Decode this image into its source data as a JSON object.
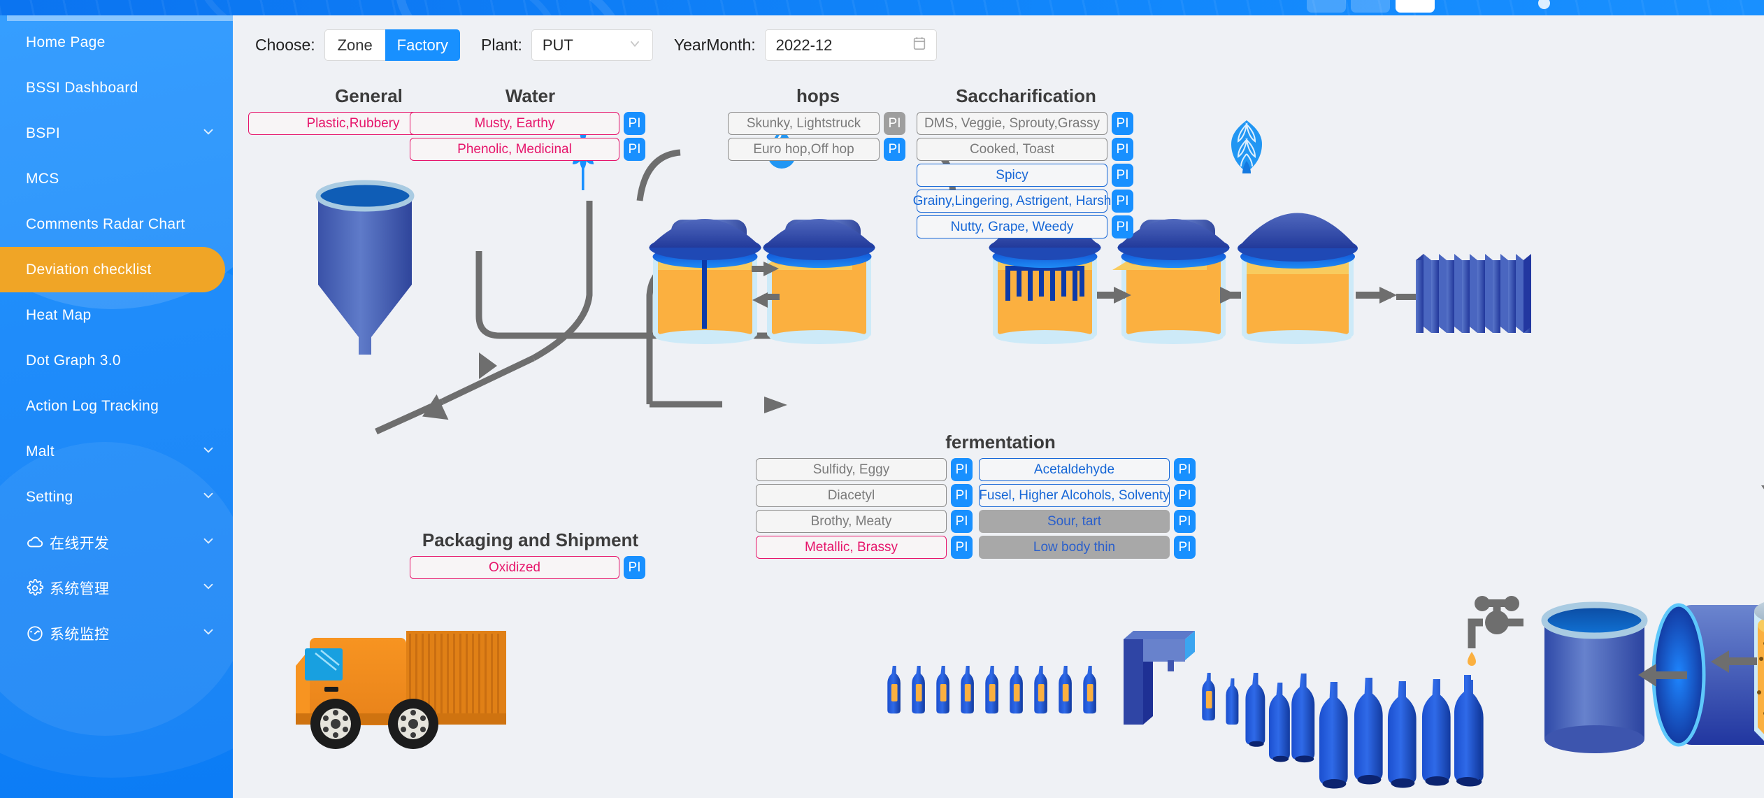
{
  "header": {
    "pill_1": "",
    "pill_2": "",
    "pill_3": ""
  },
  "sidebar": {
    "items": [
      {
        "label": "Home Page",
        "icon": "",
        "caret": false,
        "active": false
      },
      {
        "label": "BSSI Dashboard",
        "icon": "",
        "caret": false,
        "active": false
      },
      {
        "label": "BSPI",
        "icon": "",
        "caret": true,
        "active": false
      },
      {
        "label": "MCS",
        "icon": "",
        "caret": false,
        "active": false
      },
      {
        "label": "Comments Radar Chart",
        "icon": "",
        "caret": false,
        "active": false
      },
      {
        "label": "Deviation checklist",
        "icon": "",
        "caret": false,
        "active": true
      },
      {
        "label": "Heat Map",
        "icon": "",
        "caret": false,
        "active": false
      },
      {
        "label": "Dot Graph 3.0",
        "icon": "",
        "caret": false,
        "active": false
      },
      {
        "label": "Action Log Tracking",
        "icon": "",
        "caret": false,
        "active": false
      },
      {
        "label": "Malt",
        "icon": "",
        "caret": true,
        "active": false
      },
      {
        "label": "Setting",
        "icon": "",
        "caret": true,
        "active": false
      },
      {
        "label": "在线开发",
        "icon": "cloud-icon",
        "caret": true,
        "active": false
      },
      {
        "label": "系统管理",
        "icon": "gear-icon",
        "caret": true,
        "active": false
      },
      {
        "label": "系统监控",
        "icon": "gauge-icon",
        "caret": true,
        "active": false
      }
    ],
    "active_color": "#f0a526"
  },
  "toolbar": {
    "choose_label": "Choose:",
    "segment": {
      "options": [
        "Zone",
        "Factory"
      ],
      "selected": "Factory"
    },
    "plant_label": "Plant:",
    "plant_value": "PUT",
    "yearmonth_label": "YearMonth:",
    "yearmonth_value": "2022-12"
  },
  "colors": {
    "accent": "#1890ff",
    "active_nav": "#f0a526",
    "chip_neutral": "#8c8c8c",
    "chip_blue": "#1566d6",
    "chip_pink": "#e6156b",
    "chip_filled_bg": "#a8a8a8",
    "pi_disabled": "#9e9e9e",
    "background": "#eff1f5"
  },
  "groups": {
    "general": {
      "title": "General",
      "rows": [
        {
          "label": "Plastic,Rubbery",
          "state": "pink",
          "pi": "PI",
          "pi_enabled": true
        }
      ]
    },
    "water": {
      "title": "Water",
      "rows": [
        {
          "label": "Musty, Earthy",
          "state": "pink",
          "pi": "PI",
          "pi_enabled": true
        },
        {
          "label": "Phenolic, Medicinal",
          "state": "pink",
          "pi": "PI",
          "pi_enabled": true
        }
      ]
    },
    "hops": {
      "title": "hops",
      "rows": [
        {
          "label": "Skunky, Lightstruck",
          "state": "neutral",
          "pi": "PI",
          "pi_enabled": false
        },
        {
          "label": "Euro hop,Off hop",
          "state": "neutral",
          "pi": "PI",
          "pi_enabled": true
        }
      ]
    },
    "saccharification": {
      "title": "Saccharification",
      "rows": [
        {
          "label": "DMS, Veggie, Sprouty,Grassy",
          "state": "neutral",
          "pi": "PI",
          "pi_enabled": true
        },
        {
          "label": "Cooked, Toast",
          "state": "neutral",
          "pi": "PI",
          "pi_enabled": true
        },
        {
          "label": "Spicy",
          "state": "blue",
          "pi": "PI",
          "pi_enabled": true
        },
        {
          "label": "Grainy,Lingering, Astrigent, Harsh",
          "state": "blue",
          "pi": "PI",
          "pi_enabled": true
        },
        {
          "label": "Nutty, Grape, Weedy",
          "state": "blue",
          "pi": "PI",
          "pi_enabled": true
        }
      ]
    },
    "fermentation": {
      "title": "fermentation",
      "left_rows": [
        {
          "label": "Sulfidy, Eggy",
          "state": "neutral",
          "pi": "PI",
          "pi_enabled": true
        },
        {
          "label": "Diacetyl",
          "state": "neutral",
          "pi": "PI",
          "pi_enabled": true
        },
        {
          "label": "Brothy, Meaty",
          "state": "neutral",
          "pi": "PI",
          "pi_enabled": true
        },
        {
          "label": "Metallic, Brassy",
          "state": "pink",
          "pi": "PI",
          "pi_enabled": true
        }
      ],
      "right_rows": [
        {
          "label": "Acetaldehyde",
          "state": "blue",
          "pi": "PI",
          "pi_enabled": true
        },
        {
          "label": "Fusel, Higher Alcohols, Solventy",
          "state": "blue",
          "pi": "PI",
          "pi_enabled": true
        },
        {
          "label": "Sour, tart",
          "state": "filled",
          "pi": "PI",
          "pi_enabled": true
        },
        {
          "label": "Low body thin",
          "state": "filled",
          "pi": "PI",
          "pi_enabled": true
        }
      ]
    },
    "packaging": {
      "title": "Packaging and Shipment",
      "rows": [
        {
          "label": "Oxidized",
          "state": "pink",
          "pi": "PI",
          "pi_enabled": true
        }
      ]
    }
  },
  "diagram": {
    "icons": [
      "wheat-icon",
      "water-drop-icon",
      "hop-cone-icon",
      "yeast-icon"
    ],
    "equipment": [
      "grain-silo",
      "mash-tun",
      "lauter-tun",
      "rake-vessel",
      "brew-kettle",
      "whirlpool",
      "plate-heat-exchanger",
      "fermentation-tank",
      "bright-beer-tank",
      "filler-machine",
      "bottle-line",
      "delivery-truck",
      "beer-glass"
    ]
  },
  "collapse_control": {
    "icon": "triangle-down-icon"
  }
}
